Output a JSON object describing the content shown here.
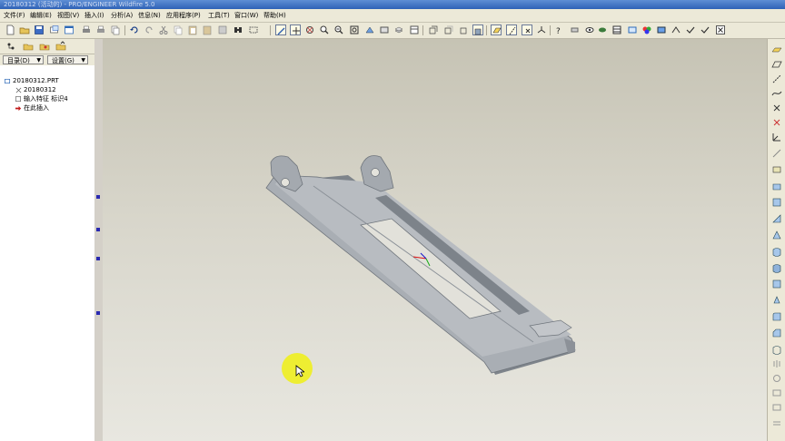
{
  "window": {
    "title": "20180312 (活动的) - PRO/ENGINEER Wildfire 5.0"
  },
  "menu": [
    {
      "label": "文件(F)"
    },
    {
      "label": "编辑(E)"
    },
    {
      "label": "视图(V)"
    },
    {
      "label": "插入(I)"
    },
    {
      "label": "分析(A)"
    },
    {
      "label": "信息(N)"
    },
    {
      "label": "应用程序(P)"
    },
    {
      "label": "工具(T)"
    },
    {
      "label": "窗口(W)"
    },
    {
      "label": "帮助(H)"
    }
  ],
  "left_panel": {
    "dropdown_show": "目录(D)",
    "dropdown_settings": "设置(G)",
    "tree": {
      "root": "20180312.PRT",
      "items": [
        "20180312",
        "输入特征 标识4",
        "在此插入"
      ]
    }
  },
  "colors": {
    "accent": "#2f62b6",
    "model": "#a9aeb4",
    "model_shadow": "#7e848b",
    "cursor_halo": "#f0f014"
  }
}
